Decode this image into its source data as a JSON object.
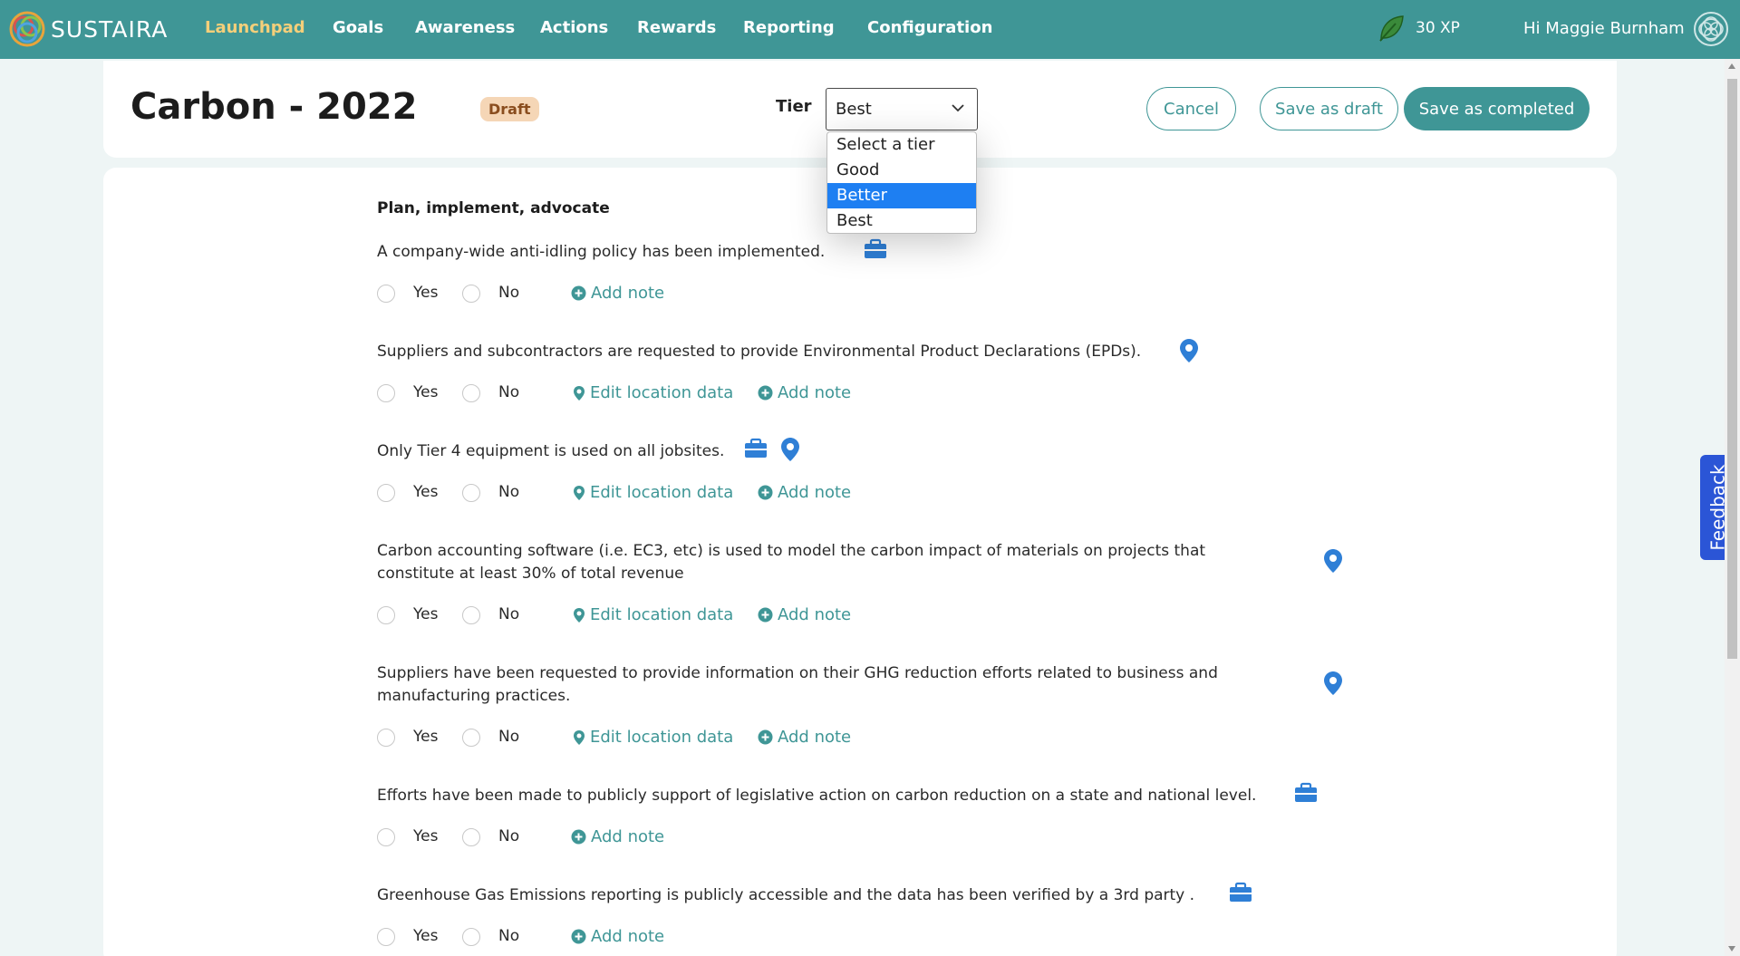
{
  "brand": {
    "name": "SUSTAIRA"
  },
  "nav": {
    "items": [
      {
        "label": "Launchpad",
        "active": true
      },
      {
        "label": "Goals",
        "active": false
      },
      {
        "label": "Awareness",
        "active": false
      },
      {
        "label": "Actions",
        "active": false
      },
      {
        "label": "Rewards",
        "active": false
      },
      {
        "label": "Reporting",
        "active": false
      },
      {
        "label": "Configuration",
        "active": false
      }
    ],
    "xp": "30 XP",
    "greeting": "Hi Maggie Burnham"
  },
  "header": {
    "title": "Carbon - 2022",
    "badge": "Draft",
    "tier_label": "Tier",
    "tier_value": "Best",
    "cancel_label": "Cancel",
    "save_draft_label": "Save as draft",
    "save_completed_label": "Save as completed"
  },
  "tier_dropdown": {
    "options": [
      "Select a tier",
      "Good",
      "Better",
      "Best"
    ],
    "highlighted": "Better"
  },
  "section": {
    "title": "Plan, implement, advocate",
    "yes_label": "Yes",
    "no_label": "No",
    "add_note_label": "Add note",
    "edit_location_label": "Edit location data",
    "questions": [
      {
        "text": "A company-wide anti-idling policy has been implemented.",
        "icons": [
          "briefcase-icon"
        ]
      },
      {
        "text": "Suppliers and subcontractors are requested to provide Environmental Product Declarations (EPDs).",
        "icons": [
          "location-pin-icon"
        ]
      },
      {
        "text": "Only Tier 4 equipment is used on all jobsites.",
        "icons": [
          "briefcase-icon",
          "location-pin-icon"
        ]
      },
      {
        "text": "Carbon accounting software (i.e. EC3, etc) is used to model the carbon impact of materials on projects that constitute at least 30% of total revenue",
        "icons": [
          "location-pin-icon"
        ]
      },
      {
        "text": "Suppliers have been requested to provide information on their GHG reduction efforts related to business and manufacturing practices.",
        "icons": [
          "location-pin-icon"
        ]
      },
      {
        "text": "Efforts have been made to publicly support of legislative action on carbon reduction on a state and national level.",
        "icons": [
          "briefcase-icon"
        ]
      },
      {
        "text": "Greenhouse Gas Emissions reporting is publicly accessible and the data has been verified by a 3rd party .",
        "icons": [
          "briefcase-icon"
        ]
      }
    ]
  },
  "feedback_tab": {
    "label": "Feedback"
  },
  "colors": {
    "primary": "#3f9696",
    "active_nav": "#f4cf7a",
    "feedback": "#2b55d6",
    "icon_blue": "#2f7fd6"
  }
}
